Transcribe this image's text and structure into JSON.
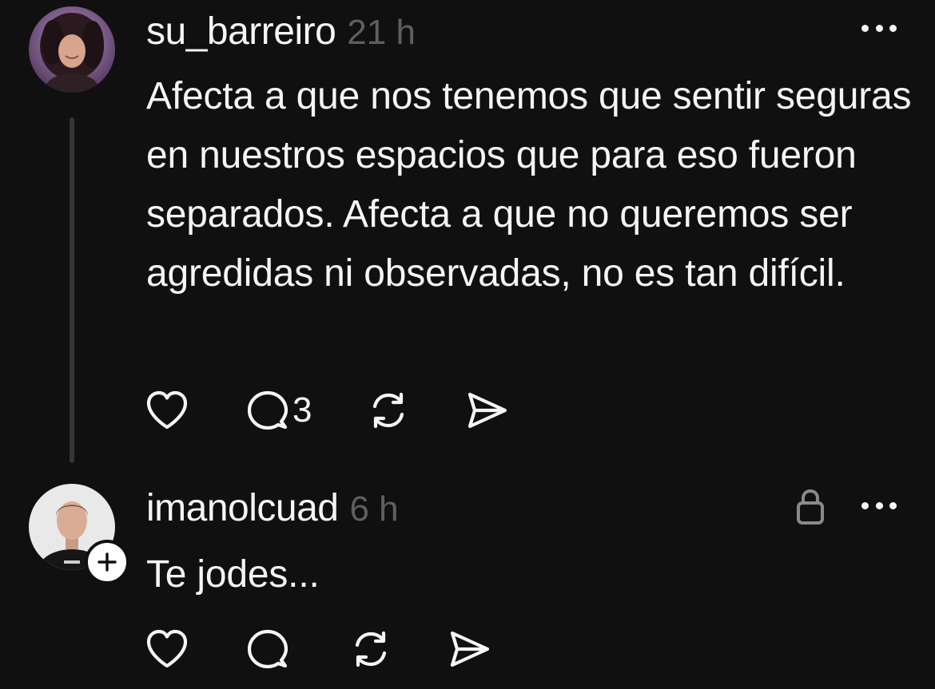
{
  "posts": [
    {
      "username": "su_barreiro",
      "time": "21 h",
      "text": "Afecta a que nos tenemos que sentir seguras en nuestros espacios que para eso fueron separados. Afecta a que no queremos ser agredidas ni observadas, no es tan difícil.",
      "reply_count": "3",
      "icons": [
        "heart-icon",
        "comment-icon",
        "repost-icon",
        "share-icon",
        "more-icon"
      ]
    },
    {
      "username": "imanolcuad",
      "time": "6 h",
      "text": "Te jodes...",
      "icons": [
        "heart-icon",
        "comment-icon",
        "repost-icon",
        "share-icon",
        "lock-icon",
        "more-icon",
        "follow-plus-icon"
      ]
    }
  ],
  "colors": {
    "background": "#101010",
    "text": "#f3f5f7",
    "muted": "#5f5f5f",
    "thread_line": "#333638"
  }
}
